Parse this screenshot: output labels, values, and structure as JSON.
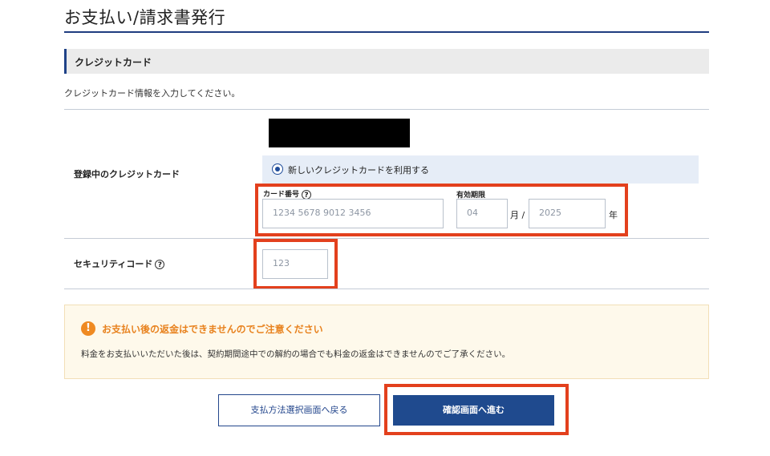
{
  "header": {
    "title": "お支払い/請求書発行"
  },
  "section": {
    "title": "クレジットカード",
    "intro": "クレジットカード情報を入力してください。"
  },
  "card_row": {
    "label": "登録中のクレジットカード",
    "radio_label": "新しいクレジットカードを利用する",
    "card_number_label": "カード番号",
    "card_number_placeholder": "1234 5678 9012 3456",
    "expiry_label": "有効期限",
    "month_placeholder": "04",
    "month_unit": "月 /",
    "year_placeholder": "2025",
    "year_unit": "年",
    "help_glyph": "?"
  },
  "security_row": {
    "label": "セキュリティコード",
    "placeholder": "123",
    "help_glyph": "?"
  },
  "notice": {
    "icon_glyph": "!",
    "title": "お支払い後の返金はできませんのでご注意ください",
    "text": "料金をお支払いいただいた後は、契約期間途中での解約の場合でも料金の返金はできませんのでご了承ください。"
  },
  "buttons": {
    "back_label": "支払方法選択画面へ戻る",
    "next_label": "確認画面へ進む"
  },
  "colors": {
    "accent": "#1f4a8e",
    "highlight": "#e3401d",
    "warning": "#ef8a22"
  }
}
